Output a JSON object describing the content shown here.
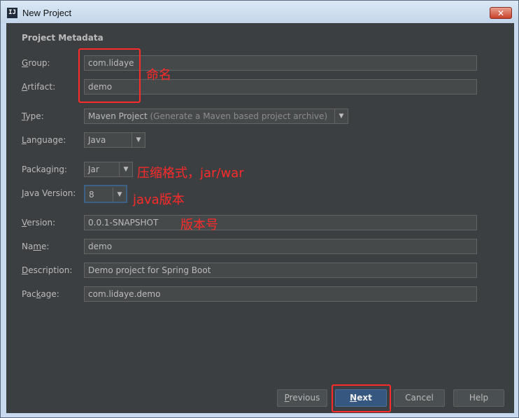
{
  "window": {
    "title": "New Project",
    "app_icon_text": "IJ",
    "close_symbol": "✕"
  },
  "section_title": "Project Metadata",
  "fields": {
    "group": {
      "label_pre": "",
      "label_u": "G",
      "label_post": "roup:",
      "value": "com.lidaye"
    },
    "artifact": {
      "label_pre": "",
      "label_u": "A",
      "label_post": "rtifact:",
      "value": "demo"
    },
    "type": {
      "label_pre": "",
      "label_u": "T",
      "label_post": "ype:",
      "value": "Maven Project",
      "hint": " (Generate a Maven based project archive)"
    },
    "language": {
      "label_pre": "",
      "label_u": "L",
      "label_post": "anguage:",
      "value": "Java"
    },
    "packaging": {
      "label_pre": "Packa",
      "label_u": "g",
      "label_post": "ing:",
      "value": "Jar"
    },
    "java_version": {
      "label_pre": "",
      "label_u": "J",
      "label_post": "ava Version:",
      "value": "8"
    },
    "version": {
      "label_pre": "",
      "label_u": "V",
      "label_post": "ersion:",
      "value": "0.0.1-SNAPSHOT"
    },
    "name": {
      "label_pre": "Na",
      "label_u": "m",
      "label_post": "e:",
      "value": "demo"
    },
    "description": {
      "label_pre": "",
      "label_u": "D",
      "label_post": "escription:",
      "value": "Demo project for Spring Boot"
    },
    "package": {
      "label_pre": "Pac",
      "label_u": "k",
      "label_post": "age:",
      "value": "com.lidaye.demo"
    }
  },
  "annotations": {
    "naming": "命名",
    "packaging_format": "压缩格式，jar/war",
    "java_version": "java版本",
    "version_number": "版本号"
  },
  "buttons": {
    "previous": {
      "pre": "",
      "u": "P",
      "post": "revious"
    },
    "next": {
      "pre": "",
      "u": "N",
      "post": "ext"
    },
    "cancel": {
      "label": "Cancel"
    },
    "help": {
      "label": "Help"
    }
  },
  "colors": {
    "panel_bg": "#3c3f41",
    "field_bg": "#45494a",
    "text": "#bbbbbb",
    "annotation": "#ff2a2a",
    "default_button": "#365880"
  },
  "icons": {
    "dropdown": "chevron-down-icon"
  }
}
